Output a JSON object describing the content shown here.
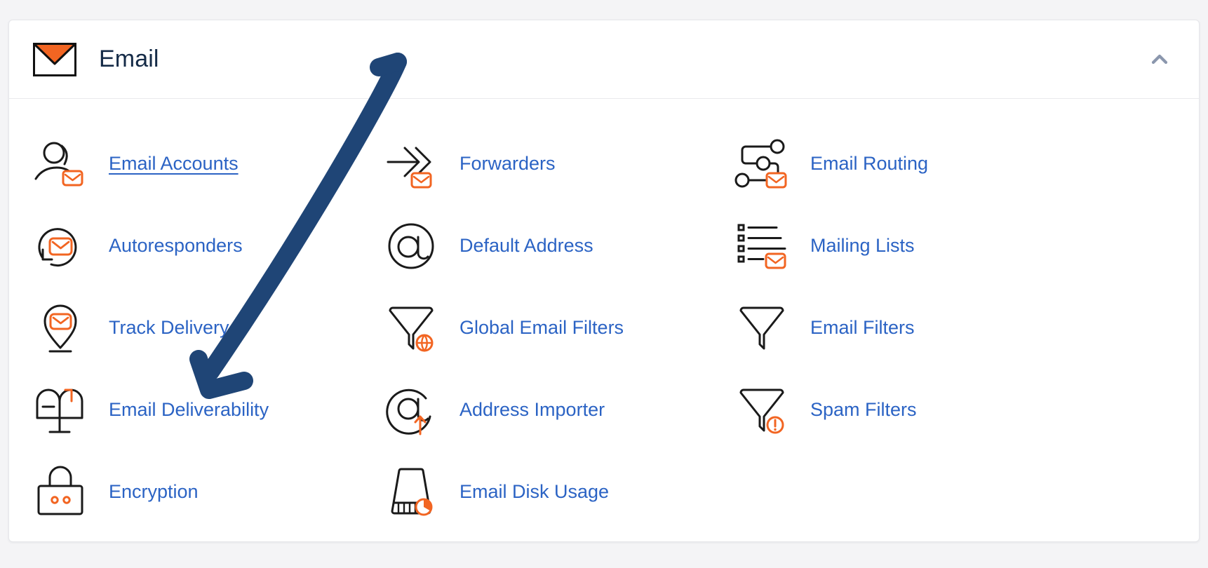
{
  "header": {
    "title": "Email",
    "icon": "envelope-icon",
    "collapse_icon": "chevron-up-icon",
    "envelope_fill": "#f26522",
    "title_color": "#152b47"
  },
  "theme": {
    "link_color": "#2b63c4",
    "accent_orange": "#f26522",
    "icon_stroke": "#1a1a1a",
    "annotation_color": "#1f4576",
    "card_background": "#ffffff",
    "page_background": "#f4f4f6"
  },
  "items": [
    {
      "label": "Email Accounts",
      "icon": "user-envelope-icon",
      "hovered": true,
      "column": 1,
      "row": 1
    },
    {
      "label": "Forwarders",
      "icon": "arrows-envelope-icon",
      "hovered": false,
      "column": 2,
      "row": 1
    },
    {
      "label": "Email Routing",
      "icon": "routing-nodes-icon",
      "hovered": false,
      "column": 3,
      "row": 1
    },
    {
      "label": "Autoresponders",
      "icon": "loop-envelope-icon",
      "hovered": false,
      "column": 1,
      "row": 2
    },
    {
      "label": "Default Address",
      "icon": "at-sign-icon",
      "hovered": false,
      "column": 2,
      "row": 2
    },
    {
      "label": "Mailing Lists",
      "icon": "list-envelope-icon",
      "hovered": false,
      "column": 3,
      "row": 2
    },
    {
      "label": "Track Delivery",
      "icon": "map-pin-envelope-icon",
      "hovered": false,
      "column": 1,
      "row": 3
    },
    {
      "label": "Global Email Filters",
      "icon": "funnel-globe-icon",
      "hovered": false,
      "column": 2,
      "row": 3
    },
    {
      "label": "Email Filters",
      "icon": "funnel-icon",
      "hovered": false,
      "column": 3,
      "row": 3
    },
    {
      "label": "Email Deliverability",
      "icon": "mailbox-icon",
      "hovered": false,
      "column": 1,
      "row": 4
    },
    {
      "label": "Address Importer",
      "icon": "at-sign-upload-icon",
      "hovered": false,
      "column": 2,
      "row": 4
    },
    {
      "label": "Spam Filters",
      "icon": "funnel-alert-icon",
      "hovered": false,
      "column": 3,
      "row": 4
    },
    {
      "label": "Encryption",
      "icon": "padlock-icon",
      "hovered": false,
      "column": 1,
      "row": 5
    },
    {
      "label": "Email Disk Usage",
      "icon": "disk-pie-icon",
      "hovered": false,
      "column": 2,
      "row": 5
    }
  ],
  "annotation": {
    "type": "hand-drawn-arrow",
    "points_to": "Email Deliverability",
    "color": "#1f4576"
  }
}
